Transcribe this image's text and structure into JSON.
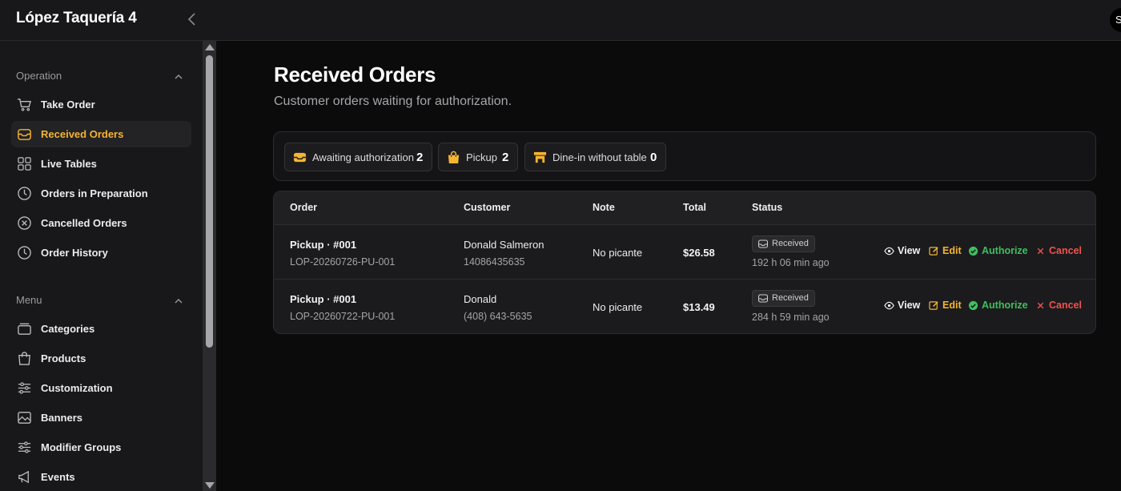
{
  "app": {
    "title": "López Taquería 4",
    "avatar_initial": "S"
  },
  "sidebar": {
    "sections": [
      {
        "label": "Operation",
        "items": [
          {
            "label": "Take Order",
            "icon": "cart-icon"
          },
          {
            "label": "Received Orders",
            "icon": "inbox-icon",
            "active": true
          },
          {
            "label": "Live Tables",
            "icon": "grid-icon"
          },
          {
            "label": "Orders in Preparation",
            "icon": "clock-icon"
          },
          {
            "label": "Cancelled Orders",
            "icon": "x-circle-icon"
          },
          {
            "label": "Order History",
            "icon": "clock-icon"
          }
        ]
      },
      {
        "label": "Menu",
        "items": [
          {
            "label": "Categories",
            "icon": "layers-icon"
          },
          {
            "label": "Products",
            "icon": "shopping-bag-icon"
          },
          {
            "label": "Customization",
            "icon": "sliders-icon"
          },
          {
            "label": "Banners",
            "icon": "image-icon"
          },
          {
            "label": "Modifier Groups",
            "icon": "sliders-icon"
          },
          {
            "label": "Events",
            "icon": "megaphone-icon"
          }
        ]
      }
    ]
  },
  "page": {
    "title": "Received Orders",
    "subtitle": "Customer orders waiting for authorization."
  },
  "stats": [
    {
      "label": "Awaiting authorization",
      "value": "2",
      "icon": "inbox-icon"
    },
    {
      "label": "Pickup",
      "value": "2",
      "icon": "shopping-bag-icon"
    },
    {
      "label": "Dine-in without table",
      "value": "0",
      "icon": "store-icon"
    }
  ],
  "table": {
    "columns": [
      "Order",
      "Customer",
      "Note",
      "Total",
      "Status"
    ],
    "rows": [
      {
        "order_title": "Pickup · #001",
        "order_code": "LOP-20260726-PU-001",
        "customer_name": "Donald Salmeron",
        "customer_phone": "14086435635",
        "note": "No picante",
        "total": "$26.58",
        "status": "Received",
        "elapsed": "192 h 06 min ago"
      },
      {
        "order_title": "Pickup · #001",
        "order_code": "LOP-20260722-PU-001",
        "customer_name": "Donald",
        "customer_phone": "(408) 643-5635",
        "note": "No picante",
        "total": "$13.49",
        "status": "Received",
        "elapsed": "284 h 59 min ago"
      }
    ],
    "actions": {
      "view": "View",
      "edit": "Edit",
      "authorize": "Authorize",
      "cancel": "Cancel"
    }
  },
  "colors": {
    "accent": "#f5b432",
    "authorize": "#3fbf5f",
    "cancel": "#ef5350"
  }
}
